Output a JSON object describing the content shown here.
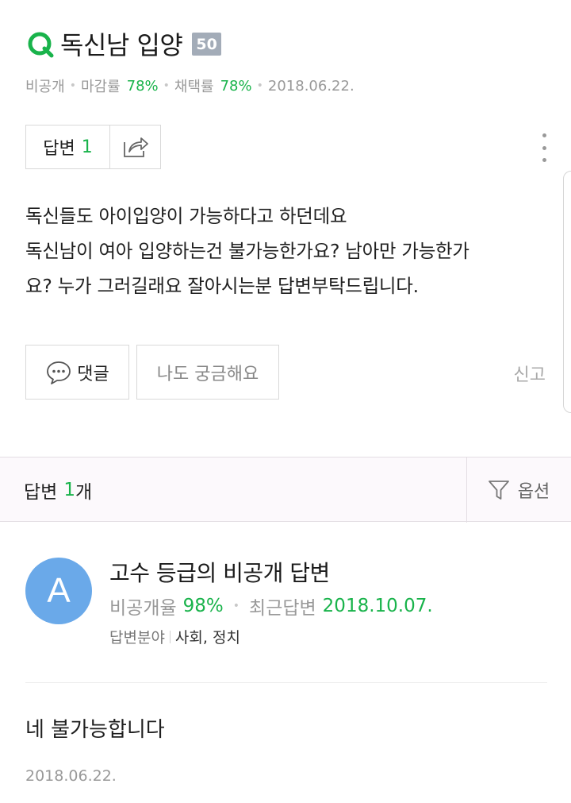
{
  "question": {
    "title": "독신남 입양",
    "points": "50",
    "meta": {
      "visibility": "비공개",
      "close_rate_label": "마감률",
      "close_rate": "78%",
      "adopt_rate_label": "채택률",
      "adopt_rate": "78%",
      "date": "2018.06.22."
    },
    "answer_count_label": "답변",
    "answer_count": "1",
    "body": [
      "독신들도 아이입양이 가능하다고 하던데요",
      "독신남이 여아 입양하는건 불가능한가요? 남아만 가능한가",
      "요? 누가 그러길래요 잘아시는분 답변부탁드립니다."
    ],
    "comment_label": "댓글",
    "curious_label": "나도 궁금해요",
    "report_label": "신고"
  },
  "answers_header": {
    "label": "답변",
    "count": "1",
    "suffix": "개",
    "option_label": "옵션"
  },
  "answer": {
    "avatar_letter": "A",
    "author": "고수 등급의 비공개 답변",
    "private_rate_label": "비공개율",
    "private_rate": "98%",
    "recent_label": "최근답변",
    "recent_date": "2018.10.07.",
    "field_label": "답변분야",
    "field_value": "사회, 정치",
    "body": "네 불가능합니다",
    "date": "2018.06.22."
  },
  "colors": {
    "accent_green": "#19b34b",
    "avatar_blue": "#6aa9e9",
    "points_badge": "#a3acb8"
  },
  "icons": [
    "q-logo-icon",
    "share-icon",
    "more-icon",
    "comment-icon",
    "filter-icon"
  ]
}
